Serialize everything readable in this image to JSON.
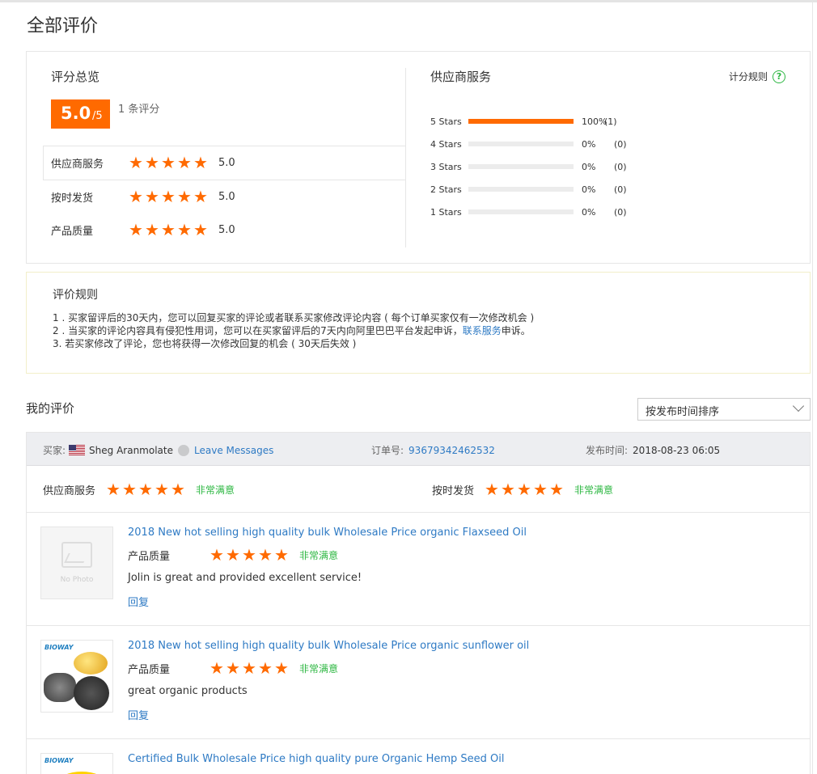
{
  "page": {
    "title": "全部评价"
  },
  "summary": {
    "title": "评分总览",
    "score": "5.0",
    "score_suffix": "/5",
    "rating_count": "1 条评分",
    "ratings": [
      {
        "label": "供应商服务",
        "stars": 5,
        "value": "5.0"
      },
      {
        "label": "按时发货",
        "stars": 5,
        "value": "5.0"
      },
      {
        "label": "产品质量",
        "stars": 5,
        "value": "5.0"
      }
    ]
  },
  "supplier": {
    "title": "供应商服务",
    "rules_link": "计分规则",
    "help_icon": "question-circle-icon",
    "distribution": [
      {
        "label": "5 Stars",
        "fraction": 1.0,
        "pct": "100%",
        "count": "(1)"
      },
      {
        "label": "4 Stars",
        "fraction": 0,
        "pct": "0%",
        "count": "(0)"
      },
      {
        "label": "3 Stars",
        "fraction": 0,
        "pct": "0%",
        "count": "(0)"
      },
      {
        "label": "2 Stars",
        "fraction": 0,
        "pct": "0%",
        "count": "(0)"
      },
      {
        "label": "1 Stars",
        "fraction": 0,
        "pct": "0%",
        "count": "(0)"
      }
    ]
  },
  "rules": {
    "title": "评价规则",
    "line1": "1 . 买家留评后的30天内，您可以回复买家的评论或者联系买家修改评论内容 ( 每个订单买家仅有一次修改机会 )",
    "line2_pre": "2 . 当买家的评论内容具有侵犯性用词，您可以在买家留评后的7天内向阿里巴巴平台发起申诉，",
    "line2_link": "联系服务",
    "line2_post": "申诉。",
    "line3": "3. 若买家修改了评论，您也将获得一次修改回复的机会 ( 30天后失效 )"
  },
  "my_reviews": {
    "title": "我的评价",
    "sort_value": "按发布时间排序"
  },
  "review": {
    "buyer_label": "买家:",
    "buyer_name": "Sheg Aranmolate",
    "leave_message": "Leave Messages",
    "order_label": "订单号:",
    "order_no": "93679342462532",
    "date_label": "发布时间:",
    "date": "2018-08-23 06:05",
    "service_label": "供应商服务",
    "service_stars": 5,
    "service_text": "非常满意",
    "shipping_label": "按时发货",
    "shipping_stars": 5,
    "shipping_text": "非常满意",
    "products": [
      {
        "title": "2018 New hot selling high quality bulk Wholesale Price organic Flaxseed Oil",
        "quality_label": "产品质量",
        "stars": 5,
        "satisfaction": "非常满意",
        "comment": "Jolin is great and provided excellent service!",
        "reply": "回复",
        "no_photo": "No Photo"
      },
      {
        "title": "2018 New hot selling high quality bulk Wholesale Price organic sunflower oil",
        "quality_label": "产品质量",
        "stars": 5,
        "satisfaction": "非常满意",
        "comment": "great organic products",
        "reply": "回复",
        "brand": "BIOWAY"
      },
      {
        "title": "Certified Bulk Wholesale Price high quality pure Organic Hemp Seed Oil",
        "brand": "BIOWAY"
      }
    ]
  },
  "colors": {
    "accent": "#ff6a00",
    "link": "#2e7ac4",
    "satisfied": "#2db742"
  }
}
